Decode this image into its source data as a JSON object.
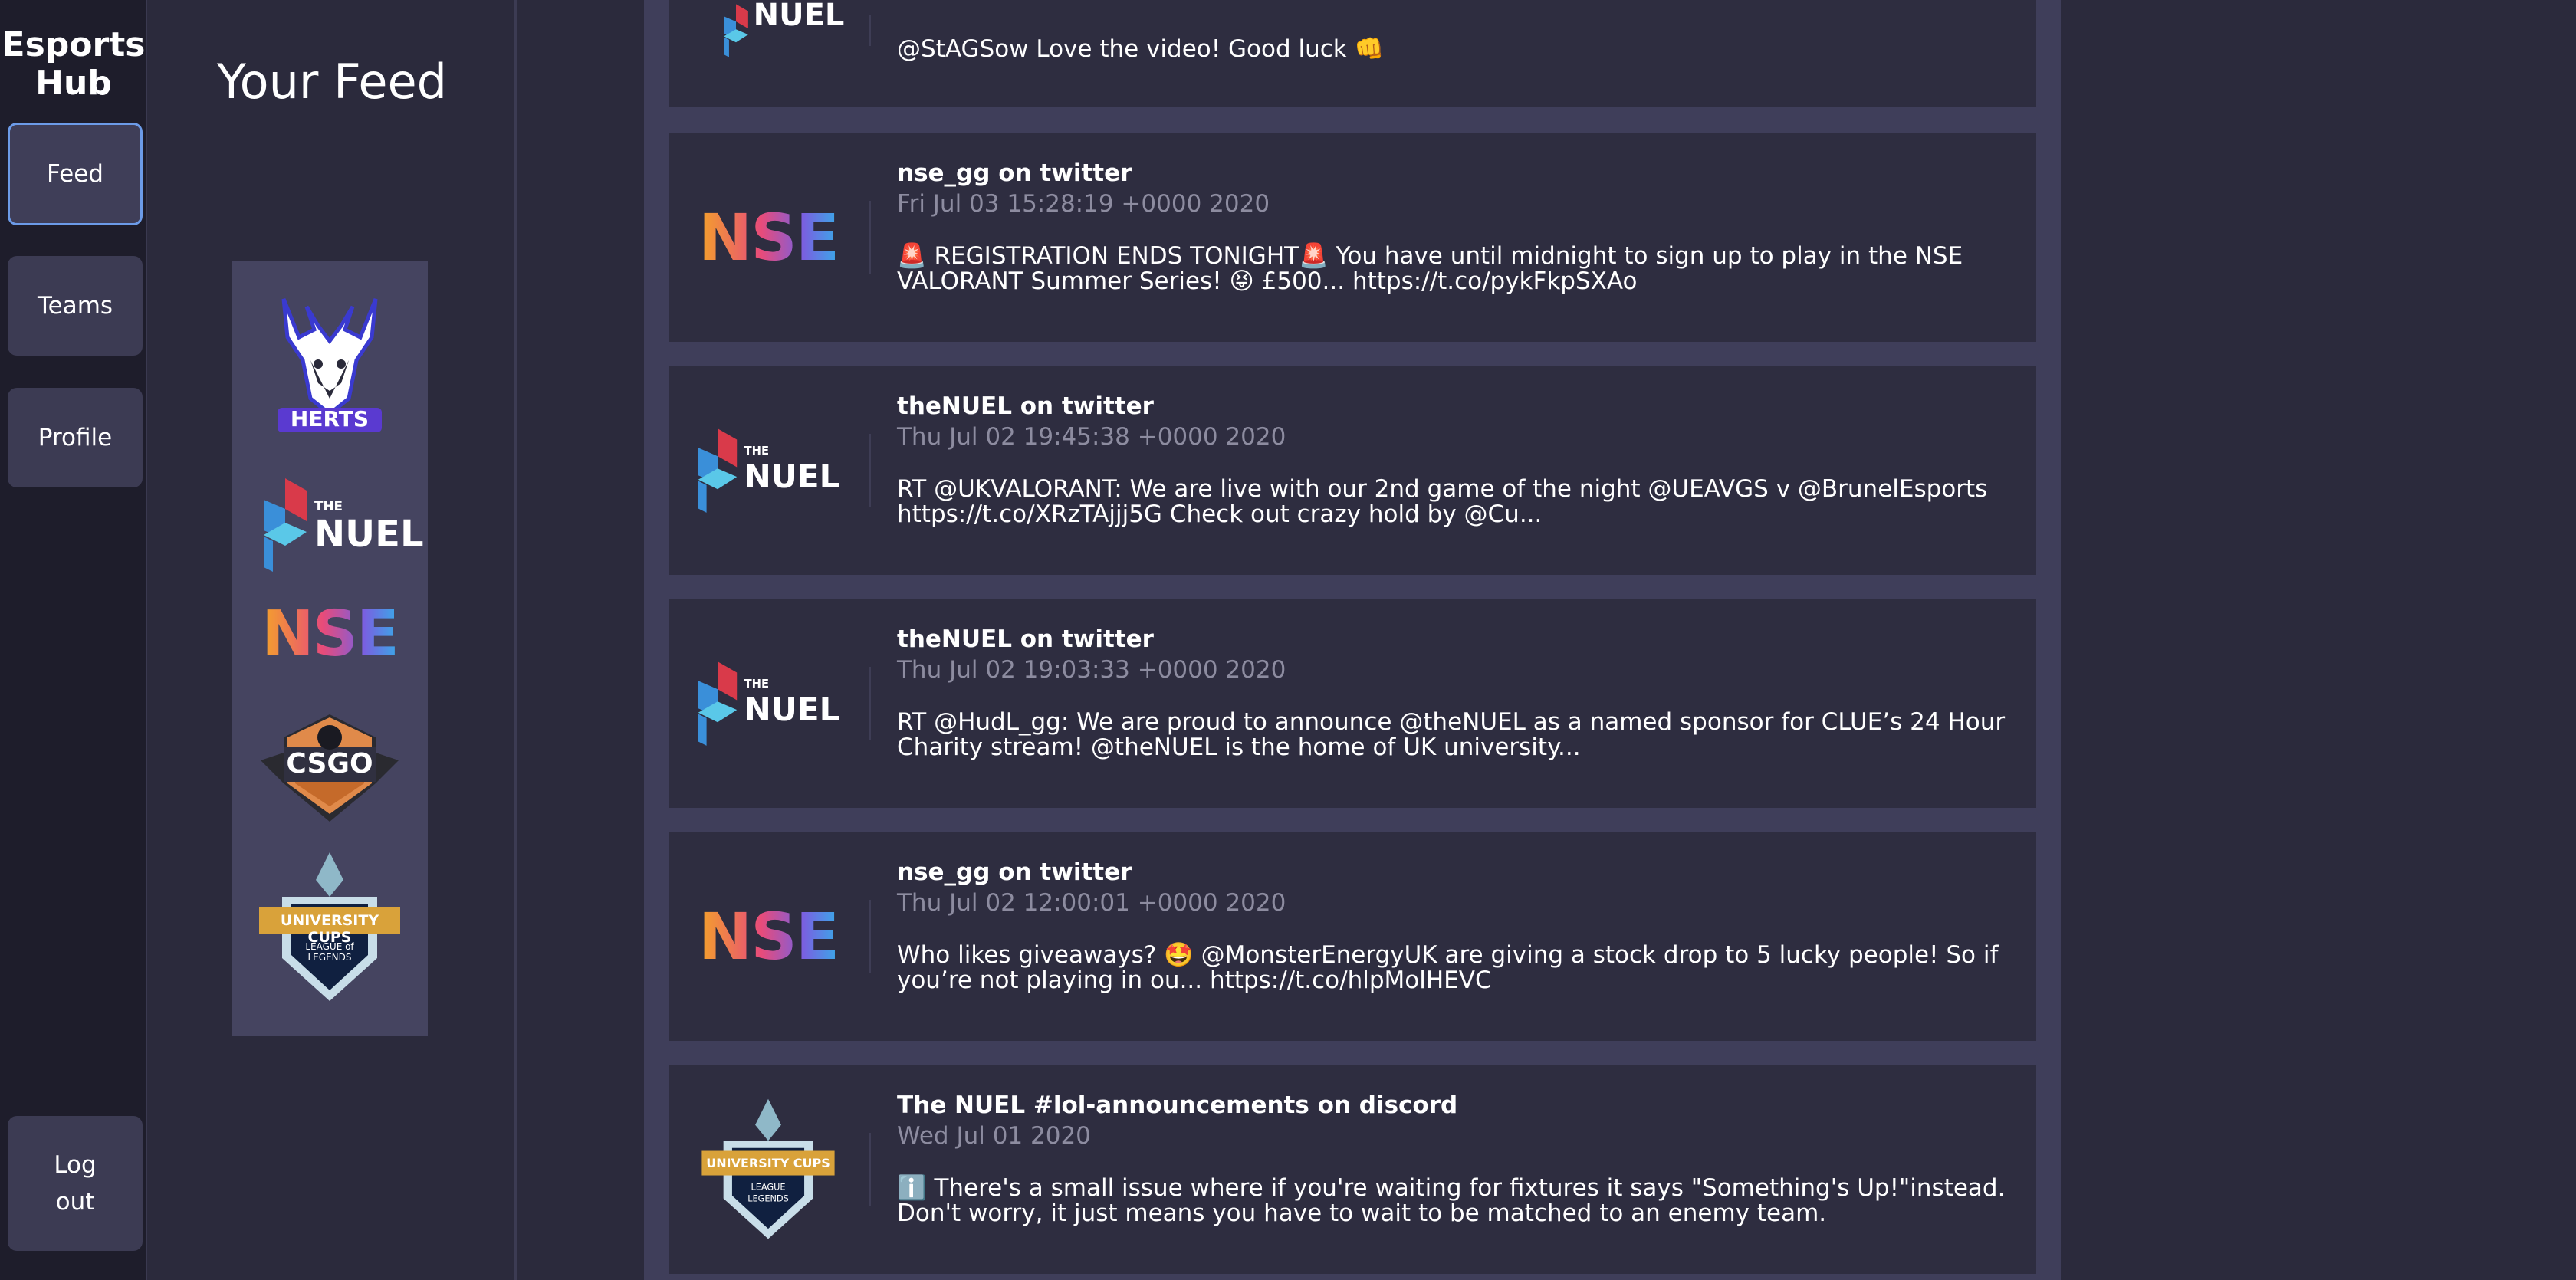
{
  "app": {
    "brand_line1": "Esports",
    "brand_line2": "Hub"
  },
  "nav": {
    "feed": "Feed",
    "teams": "Teams",
    "profile": "Profile",
    "logout_line1": "Log",
    "logout_line2": "out"
  },
  "feed": {
    "title": "Your Feed",
    "followed_logos": [
      {
        "icon": "herts-logo",
        "text": "HERTS"
      },
      {
        "icon": "nuel-logo",
        "the": "THE",
        "text": "NUEL"
      },
      {
        "icon": "nse-logo",
        "text": "NSE"
      },
      {
        "icon": "csgo-logo",
        "text": "CSGO"
      },
      {
        "icon": "university-cups-logo",
        "text": "UNIVERSITY CUPS",
        "sub": "LEAGUE of LEGENDS"
      }
    ]
  },
  "logos": {
    "nse": "NSE",
    "nuel_the": "THE",
    "nuel": "NUEL",
    "cups_banner": "UNIVERSITY CUPS",
    "cups_sub1": "LEAGUE",
    "cups_sub2": "LEGENDS"
  },
  "posts": [
    {
      "logo": "nuel-logo",
      "text": "@StAGSow Love the video! Good luck 👊"
    },
    {
      "logo": "nse-logo",
      "author": "nse_gg on twitter",
      "date": "Fri Jul 03 15:28:19 +0000 2020",
      "text": "🚨 REGISTRATION ENDS TONIGHT🚨  You have until midnight to sign up to play in the NSE VALORANT Summer Series! 😝  £500... https://t.co/pykFkpSXAo"
    },
    {
      "logo": "nuel-logo",
      "author": "theNUEL on twitter",
      "date": "Thu Jul 02 19:45:38 +0000 2020",
      "text": "RT @UKVALORANT: We are live with our 2nd game of the night @UEAVGS v @BrunelEsports https://t.co/XRzTAjjj5G Check out crazy hold by @Cu..."
    },
    {
      "logo": "nuel-logo",
      "author": "theNUEL on twitter",
      "date": "Thu Jul 02 19:03:33 +0000 2020",
      "text": "RT @HudL_gg: We are proud to announce @theNUEL as a named sponsor for CLUE’s 24 Hour Charity stream! @theNUEL is the home of UK university..."
    },
    {
      "logo": "nse-logo",
      "author": "nse_gg on twitter",
      "date": "Thu Jul 02 12:00:01 +0000 2020",
      "text": "Who likes giveaways? 🤩  @MonsterEnergyUK are giving a stock drop to 5 lucky people! So if you’re not playing in ou... https://t.co/hlpMolHEVC"
    },
    {
      "logo": "university-cups-logo",
      "author": "The NUEL #lol-announcements on discord",
      "date": "Wed Jul 01 2020",
      "text": "ℹ️  There's a small issue where if you're waiting for fixtures it says \"Something's Up!\"instead. Don't worry, it just means you have to wait to be matched to an enemy team."
    }
  ],
  "colors": {
    "nav_bg": "#1e1d2b",
    "page_bg": "#2b2a3c",
    "card_bg": "#2e2d40",
    "posts_bg": "#3f3e5a",
    "active_border": "#6c9be8",
    "muted_text": "#8d8ca0"
  }
}
